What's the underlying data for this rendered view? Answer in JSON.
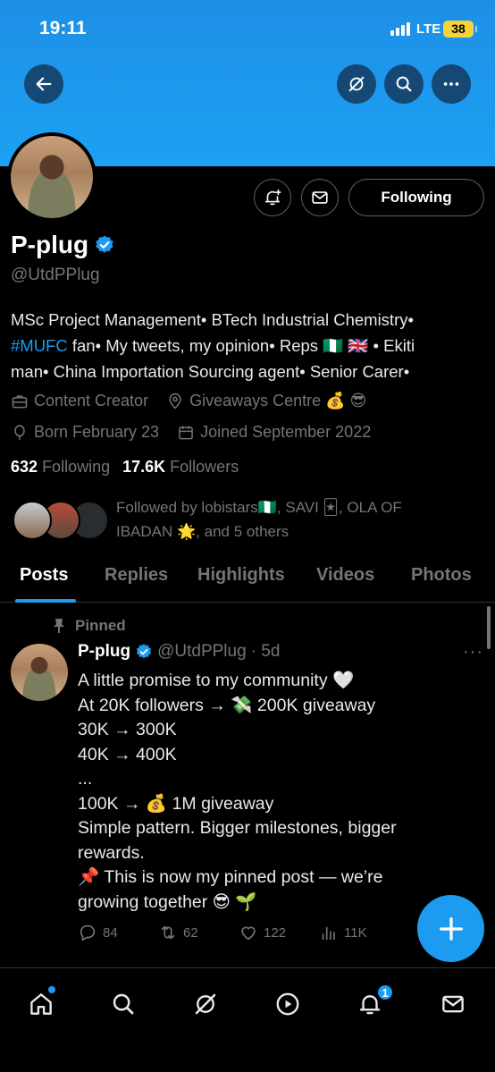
{
  "status_bar": {
    "time": "19:11",
    "network": "LTE",
    "battery": "38"
  },
  "profile": {
    "name": "P-plug",
    "handle": "@UtdPPlug",
    "following_button": "Following",
    "bio": {
      "line1": "MSc Project Management• BTech Industrial Chemistry•",
      "hashtag": "#MUFC",
      "line2_rest": " fan• My tweets, my opinion• Reps 🇳🇬 🇬🇧 • Ekiti",
      "line3": "man• China Importation Sourcing agent• Senior Carer•"
    },
    "category": "Content Creator",
    "location": "Giveaways Centre 💰 😎",
    "born": "Born February 23",
    "joined": "Joined September 2022",
    "following_count": "632",
    "following_label": "Following",
    "followers_count": "17.6K",
    "followers_label": "Followers",
    "followed_by_line1": "Followed by lobistars🇳🇬, SAVI 🃏, OLA OF",
    "followed_by_line2": "IBADAN 🌟, and 5 others"
  },
  "tabs": [
    "Posts",
    "Replies",
    "Highlights",
    "Videos",
    "Photos"
  ],
  "pinned_post": {
    "pinned_label": "Pinned",
    "name": "P-plug",
    "handle": "@UtdPPlug",
    "time": "· 5d",
    "lines": [
      "A little promise to my community 🤍",
      "At 20K followers → 💸 200K giveaway",
      "30K → 300K",
      "40K → 400K",
      "...",
      "100K → 💰 1M giveaway",
      "Simple pattern. Bigger milestones, bigger",
      "rewards.",
      "📌 This is now my pinned post — we’re",
      "growing together 😎 🌱"
    ],
    "replies": "84",
    "reposts": "62",
    "likes": "122",
    "views": "11K"
  },
  "bottom_nav": {
    "notifications_badge": "1"
  },
  "colors": {
    "accent": "#1d9bf0",
    "banner": "#1da1f2",
    "muted": "#71767b"
  }
}
